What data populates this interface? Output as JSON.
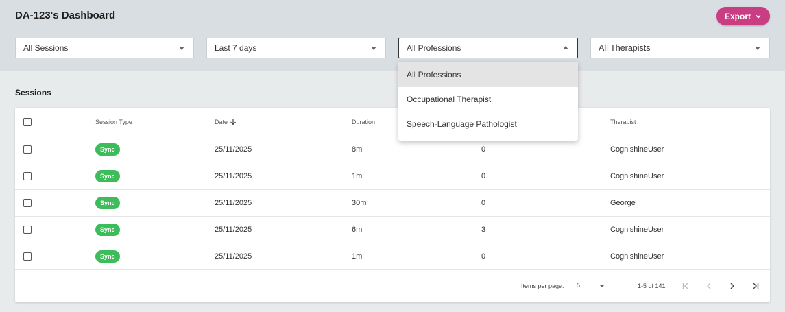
{
  "header": {
    "title": "DA-123's Dashboard",
    "export_label": "Export"
  },
  "filters": {
    "sessions": "All Sessions",
    "date_range": "Last 7 days",
    "profession": "All Professions",
    "therapist": "All Therapists"
  },
  "profession_menu": {
    "options": [
      "All Professions",
      "Occupational Therapist",
      "Speech-Language Pathologist"
    ],
    "selected": "All Professions"
  },
  "sessions": {
    "title": "Sessions",
    "columns": [
      "Session Type",
      "Date",
      "Duration",
      "",
      "Therapist"
    ],
    "rows": [
      {
        "type": "Sync",
        "date": "25/11/2025",
        "duration": "8m",
        "count": "0",
        "therapist": "CognishineUser"
      },
      {
        "type": "Sync",
        "date": "25/11/2025",
        "duration": "1m",
        "count": "0",
        "therapist": "CognishineUser"
      },
      {
        "type": "Sync",
        "date": "25/11/2025",
        "duration": "30m",
        "count": "0",
        "therapist": "George"
      },
      {
        "type": "Sync",
        "date": "25/11/2025",
        "duration": "6m",
        "count": "3",
        "therapist": "CognishineUser"
      },
      {
        "type": "Sync",
        "date": "25/11/2025",
        "duration": "1m",
        "count": "0",
        "therapist": "CognishineUser"
      }
    ]
  },
  "paginator": {
    "items_per_page_label": "Items per page:",
    "page_size": "5",
    "range_label": "1-5 of 141"
  },
  "colors": {
    "accent": "#c93d82",
    "badge_green": "#3dbd5a",
    "header_band": "#d8dee2"
  }
}
